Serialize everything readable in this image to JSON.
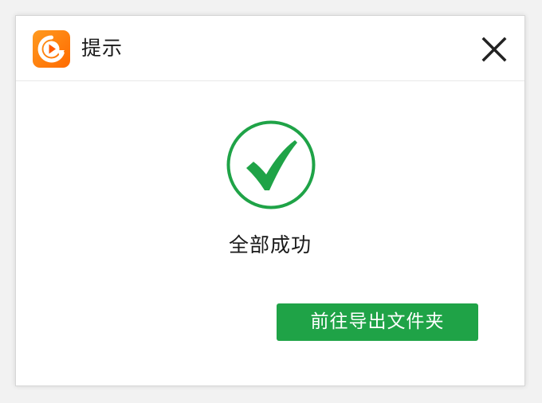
{
  "dialog": {
    "title": "提示",
    "app_icon": "play-logo-icon",
    "close_icon": "close-icon"
  },
  "content": {
    "status_icon": "check-circle-icon",
    "message": "全部成功",
    "button_label": "前往导出文件夹"
  },
  "colors": {
    "accent_green": "#1fa347",
    "logo_orange": "#ff7a00"
  }
}
